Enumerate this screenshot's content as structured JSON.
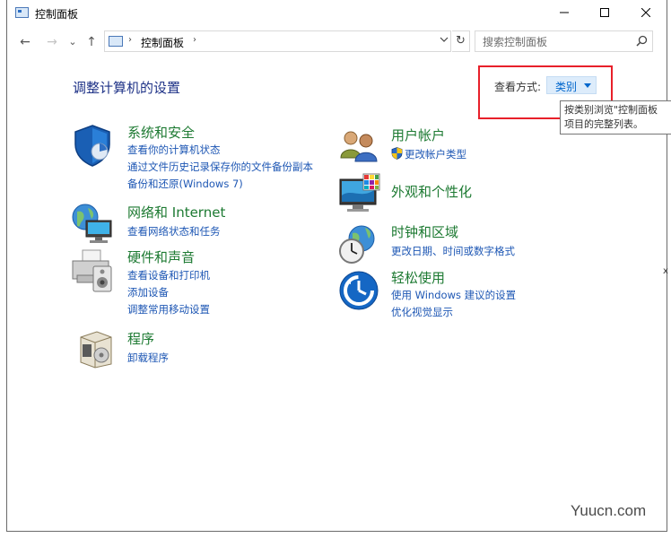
{
  "window": {
    "title": "控制面板",
    "minimize_glyph": "—",
    "maximize_glyph": "☐",
    "close_glyph": "✕"
  },
  "nav": {
    "back_glyph": "←",
    "forward_glyph": "→",
    "recent_glyph": "⌄",
    "up_glyph": "↑",
    "address_path": "控制面板",
    "address_sep": "›",
    "refresh_glyph": "↻",
    "search_placeholder": "搜索控制面板"
  },
  "header": {
    "heading": "调整计算机的设置",
    "view_by_label": "查看方式:",
    "view_by_value": "类别",
    "tooltip_line1": "按类别浏览\"控制面板",
    "tooltip_line2": "项目的完整列表。"
  },
  "categories": {
    "system": {
      "title": "系统和安全",
      "links": [
        "查看你的计算机状态",
        "通过文件历史记录保存你的文件备份副本",
        "备份和还原(Windows 7)"
      ]
    },
    "network": {
      "title": "网络和 Internet",
      "links": [
        "查看网络状态和任务"
      ]
    },
    "hardware": {
      "title": "硬件和声音",
      "links": [
        "查看设备和打印机",
        "添加设备",
        "调整常用移动设置"
      ]
    },
    "programs": {
      "title": "程序",
      "links": [
        "卸载程序"
      ]
    },
    "user": {
      "title": "用户帐户",
      "links": [
        "更改帐户类型"
      ]
    },
    "appearance": {
      "title": "外观和个性化",
      "links": []
    },
    "clock": {
      "title": "时钟和区域",
      "links": [
        "更改日期、时间或数字格式"
      ]
    },
    "ease": {
      "title": "轻松使用",
      "links": [
        "使用 Windows 建议的设置",
        "优化视觉显示"
      ]
    }
  },
  "edge_text": "x",
  "watermark": "Yuucn.com",
  "colors": {
    "category_title": "#1d7a32",
    "link": "#1e57b4",
    "heading": "#1e3287",
    "highlight_box": "#e8202a",
    "view_select_bg": "#ddecfb"
  }
}
